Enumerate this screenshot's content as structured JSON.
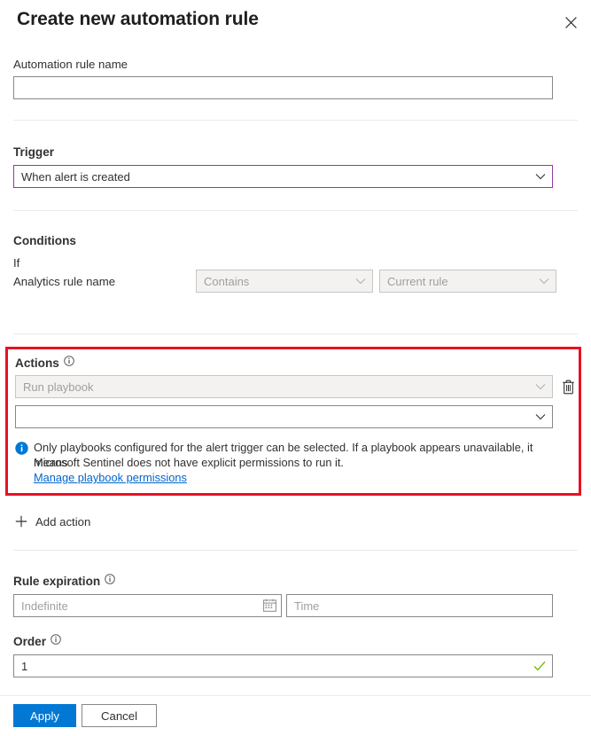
{
  "dialog": {
    "title": "Create new automation rule",
    "close_icon": "close-icon"
  },
  "name_section": {
    "label": "Automation rule name",
    "value": "",
    "placeholder": ""
  },
  "trigger_section": {
    "label": "Trigger",
    "selected": "When alert is created",
    "chevron_icon": "chevron-down-icon"
  },
  "conditions_section": {
    "heading": "Conditions",
    "if_label": "If",
    "property_label": "Analytics rule name",
    "operator": {
      "value": "Contains",
      "disabled": true
    },
    "value": {
      "value": "Current rule",
      "disabled": true
    }
  },
  "actions_section": {
    "heading": "Actions",
    "info_icon": "info-circle-icon",
    "action_type": {
      "value": "Run playbook",
      "disabled": true
    },
    "playbook": {
      "value": "",
      "disabled": false
    },
    "delete_icon": "trash-icon",
    "message": {
      "icon": "info-filled-icon",
      "line1": "Only playbooks configured for the alert trigger can be selected. If a playbook appears unavailable, it means",
      "line2": "Microsoft Sentinel does not have explicit permissions to run it.",
      "link": "Manage playbook permissions"
    },
    "add_action_label": "Add action",
    "add_action_icon": "plus-icon",
    "highlight_color": "#e81123"
  },
  "expiration_section": {
    "label": "Rule expiration",
    "info_icon": "info-circle-icon",
    "date": {
      "value": "",
      "placeholder": "Indefinite",
      "icon": "calendar-icon"
    },
    "time": {
      "value": "",
      "placeholder": "Time"
    }
  },
  "order_section": {
    "label": "Order",
    "info_icon": "info-circle-icon",
    "value": "1",
    "valid_icon": "checkmark-icon",
    "valid_color": "#6bb700"
  },
  "footer": {
    "apply_label": "Apply",
    "cancel_label": "Cancel",
    "primary_color": "#0078d4"
  }
}
